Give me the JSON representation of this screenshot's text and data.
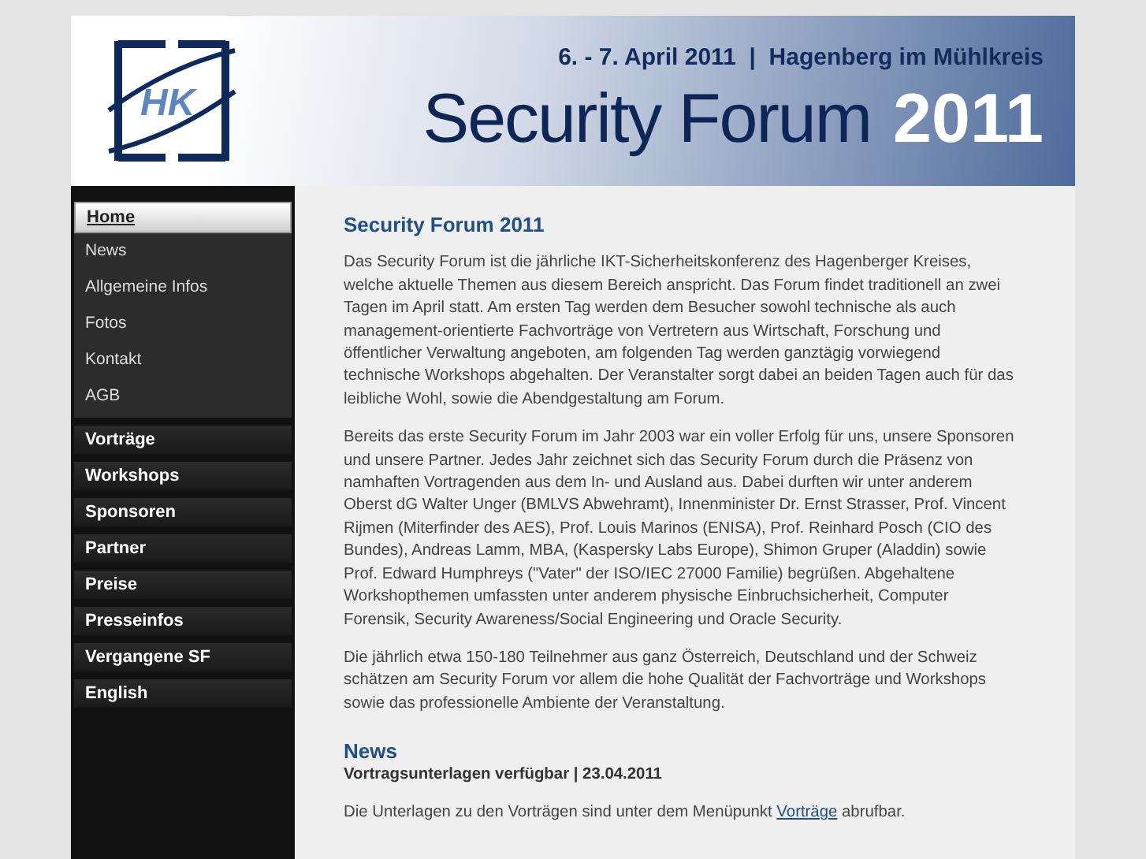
{
  "banner": {
    "date_line": "6. - 7. April 2011  |  Hagenberg im Mühlkreis",
    "title": "Security Forum",
    "year": "2011",
    "logo_text": "HK"
  },
  "nav": [
    {
      "label": "Home",
      "selected": true,
      "children": [
        {
          "label": "News"
        },
        {
          "label": "Allgemeine Infos"
        },
        {
          "label": "Fotos"
        },
        {
          "label": "Kontakt"
        },
        {
          "label": "AGB"
        }
      ]
    },
    {
      "label": "Vorträge",
      "selected": false
    },
    {
      "label": "Workshops",
      "selected": false
    },
    {
      "label": "Sponsoren",
      "selected": false
    },
    {
      "label": "Partner",
      "selected": false
    },
    {
      "label": "Preise",
      "selected": false
    },
    {
      "label": "Presseinfos",
      "selected": false
    },
    {
      "label": "Vergangene SF",
      "selected": false
    },
    {
      "label": "English",
      "selected": false
    }
  ],
  "content": {
    "heading": "Security Forum 2011",
    "paragraphs": [
      "Das Security Forum ist die jährliche IKT-Sicherheitskonferenz des Hagenberger Kreises, welche aktuelle Themen aus diesem Bereich anspricht. Das Forum findet traditionell an zwei Tagen im April statt. Am ersten Tag werden dem Besucher sowohl technische als auch management-orientierte Fachvorträge von Vertretern aus Wirtschaft, Forschung und öffentlicher Verwaltung angeboten, am folgenden Tag werden ganztägig vorwiegend technische Workshops abgehalten. Der Veranstalter sorgt dabei an beiden Tagen auch für das leibliche Wohl, sowie die Abendgestaltung am Forum.",
      "Bereits das erste Security Forum im Jahr 2003 war ein voller Erfolg für uns, unsere Sponsoren und unsere Partner. Jedes Jahr zeichnet sich das Security Forum durch die Präsenz von namhaften Vortragenden aus dem In- und Ausland aus. Dabei durften wir unter anderem Oberst dG Walter Unger (BMLVS Abwehramt), Innenminister Dr. Ernst Strasser, Prof. Vincent Rijmen (Miterfinder des AES), Prof. Louis Marinos (ENISA), Prof. Reinhard Posch (CIO des Bundes), Andreas Lamm, MBA, (Kaspersky Labs Europe), Shimon Gruper (Aladdin) sowie Prof. Edward Humphreys (\"Vater\" der ISO/IEC 27000 Familie) begrüßen. Abgehaltene Workshopthemen umfassten unter anderem physische Einbruchsicherheit, Computer Forensik, Security Awareness/Social Engineering und Oracle Security.",
      "Die jährlich etwa 150-180 Teilnehmer aus ganz Österreich, Deutschland und der Schweiz schätzen am Security Forum vor allem die hohe Qualität der Fachvorträge und Workshops sowie das professionelle Ambiente der Veranstaltung."
    ]
  },
  "news": {
    "heading": "News",
    "item_title": "Vortragsunterlagen verfügbar | 23.04.2011",
    "text_before": "Die Unterlagen zu den Vorträgen sind unter dem Menüpunkt ",
    "link": "Vorträge",
    "text_after": " abrufbar."
  }
}
